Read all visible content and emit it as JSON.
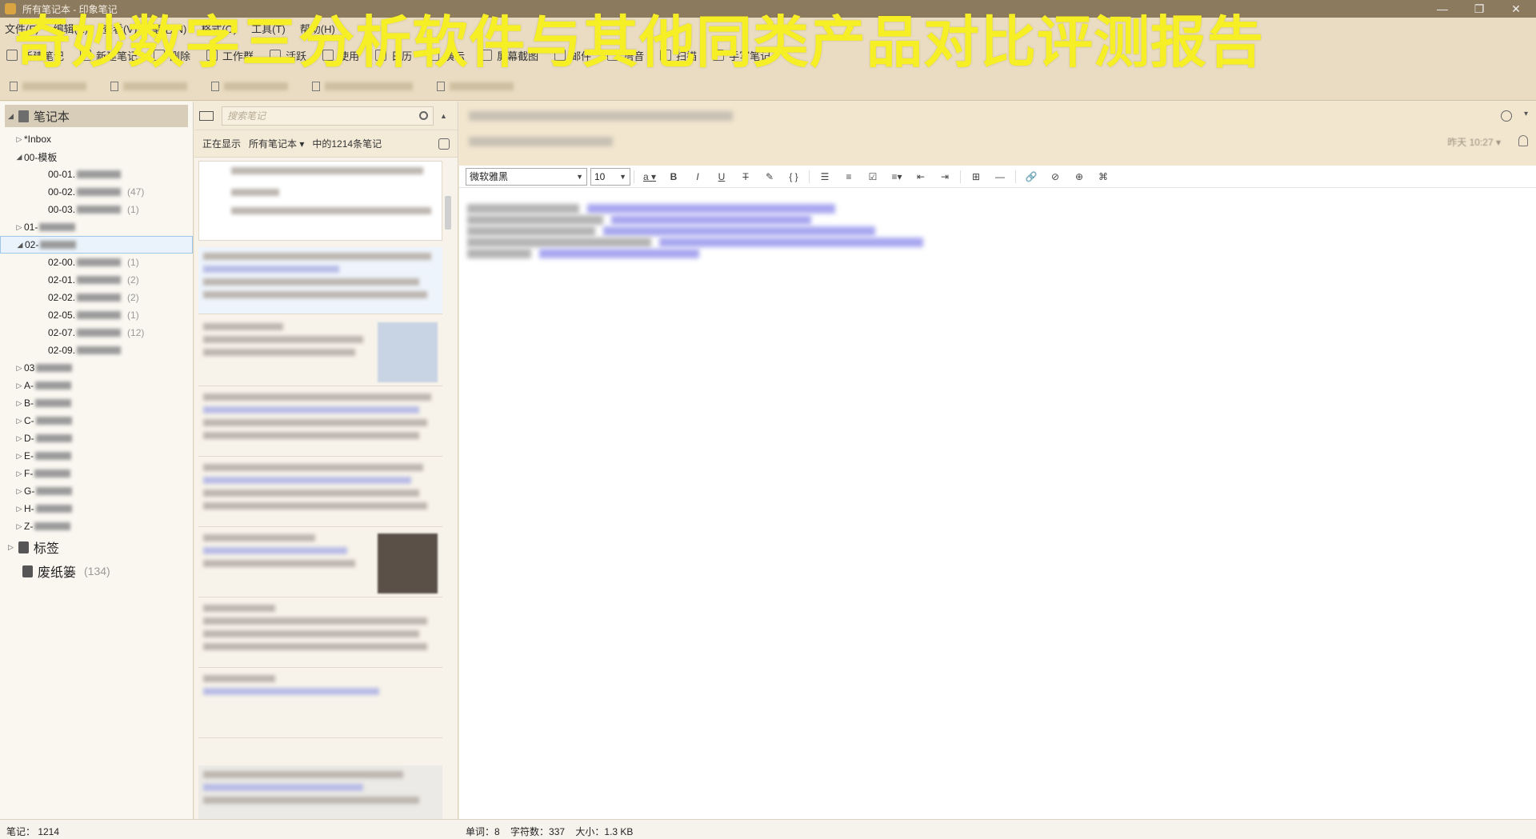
{
  "overlay_title": "奇妙数字三分析软件与其他同类产品对比评测报告",
  "window": {
    "title": "所有笔记本 - 印象笔记",
    "app_name": "印象笔记",
    "controls": [
      "—",
      "❐",
      "✕"
    ]
  },
  "menu": [
    "文件(F)",
    "编辑(E)",
    "查看(V)",
    "笔记(N)",
    "格式(O)",
    "工具(T)",
    "帮助(H)"
  ],
  "toolbar": [
    "新建笔记",
    "新建笔记",
    "删除",
    "工作群",
    "活跃",
    "使用",
    "日历",
    "演示",
    "屏幕截图",
    "邮件",
    "语音",
    "扫描",
    "手写笔记"
  ],
  "sidebar": {
    "header": "笔记本",
    "items": [
      {
        "label": "*Inbox",
        "level": 1,
        "arrow": "▷",
        "count": ""
      },
      {
        "label": "00-模板",
        "level": 1,
        "arrow": "◢",
        "count": ""
      },
      {
        "label": "00-01.",
        "level": 2,
        "arrow": "",
        "count": ""
      },
      {
        "label": "00-02.",
        "level": 2,
        "arrow": "",
        "count": "(47)"
      },
      {
        "label": "00-03.",
        "level": 2,
        "arrow": "",
        "count": "(1)"
      },
      {
        "label": "01-",
        "level": 1,
        "arrow": "▷",
        "count": ""
      },
      {
        "label": "02-",
        "level": 1,
        "arrow": "◢",
        "count": "",
        "selected": true
      },
      {
        "label": "02-00.",
        "level": 2,
        "arrow": "",
        "count": "(1)"
      },
      {
        "label": "02-01.",
        "level": 2,
        "arrow": "",
        "count": "(2)"
      },
      {
        "label": "02-02.",
        "level": 2,
        "arrow": "",
        "count": "(2)"
      },
      {
        "label": "02-05.",
        "level": 2,
        "arrow": "",
        "count": "(1)"
      },
      {
        "label": "02-07.",
        "level": 2,
        "arrow": "",
        "count": "(12)"
      },
      {
        "label": "02-09.",
        "level": 2,
        "arrow": "",
        "count": ""
      },
      {
        "label": "03",
        "level": 1,
        "arrow": "▷",
        "count": ""
      },
      {
        "label": "A-",
        "level": 1,
        "arrow": "▷",
        "count": ""
      },
      {
        "label": "B-",
        "level": 1,
        "arrow": "▷",
        "count": ""
      },
      {
        "label": "C-",
        "level": 1,
        "arrow": "▷",
        "count": ""
      },
      {
        "label": "D-",
        "level": 1,
        "arrow": "▷",
        "count": ""
      },
      {
        "label": "E-",
        "level": 1,
        "arrow": "▷",
        "count": ""
      },
      {
        "label": "F-",
        "level": 1,
        "arrow": "▷",
        "count": ""
      },
      {
        "label": "G-",
        "level": 1,
        "arrow": "▷",
        "count": ""
      },
      {
        "label": "H-",
        "level": 1,
        "arrow": "▷",
        "count": ""
      },
      {
        "label": "Z-",
        "level": 1,
        "arrow": "▷",
        "count": ""
      }
    ],
    "tags": "标签",
    "trash": "废纸篓",
    "trash_count": "(134)"
  },
  "notelist": {
    "search_placeholder": "搜索笔记",
    "filter_prefix": "正在显示",
    "filter_notebook": "所有笔记本 ▾",
    "filter_suffix": "中的1214条笔记"
  },
  "editor": {
    "timestamp": "昨天 10:27 ▾",
    "font": "微软雅黑",
    "font_size": "10"
  },
  "status": {
    "notes_count": "笔记： 1214",
    "words": "单词：8",
    "chars": "字符数：337",
    "size": "大小：1.3 KB"
  }
}
